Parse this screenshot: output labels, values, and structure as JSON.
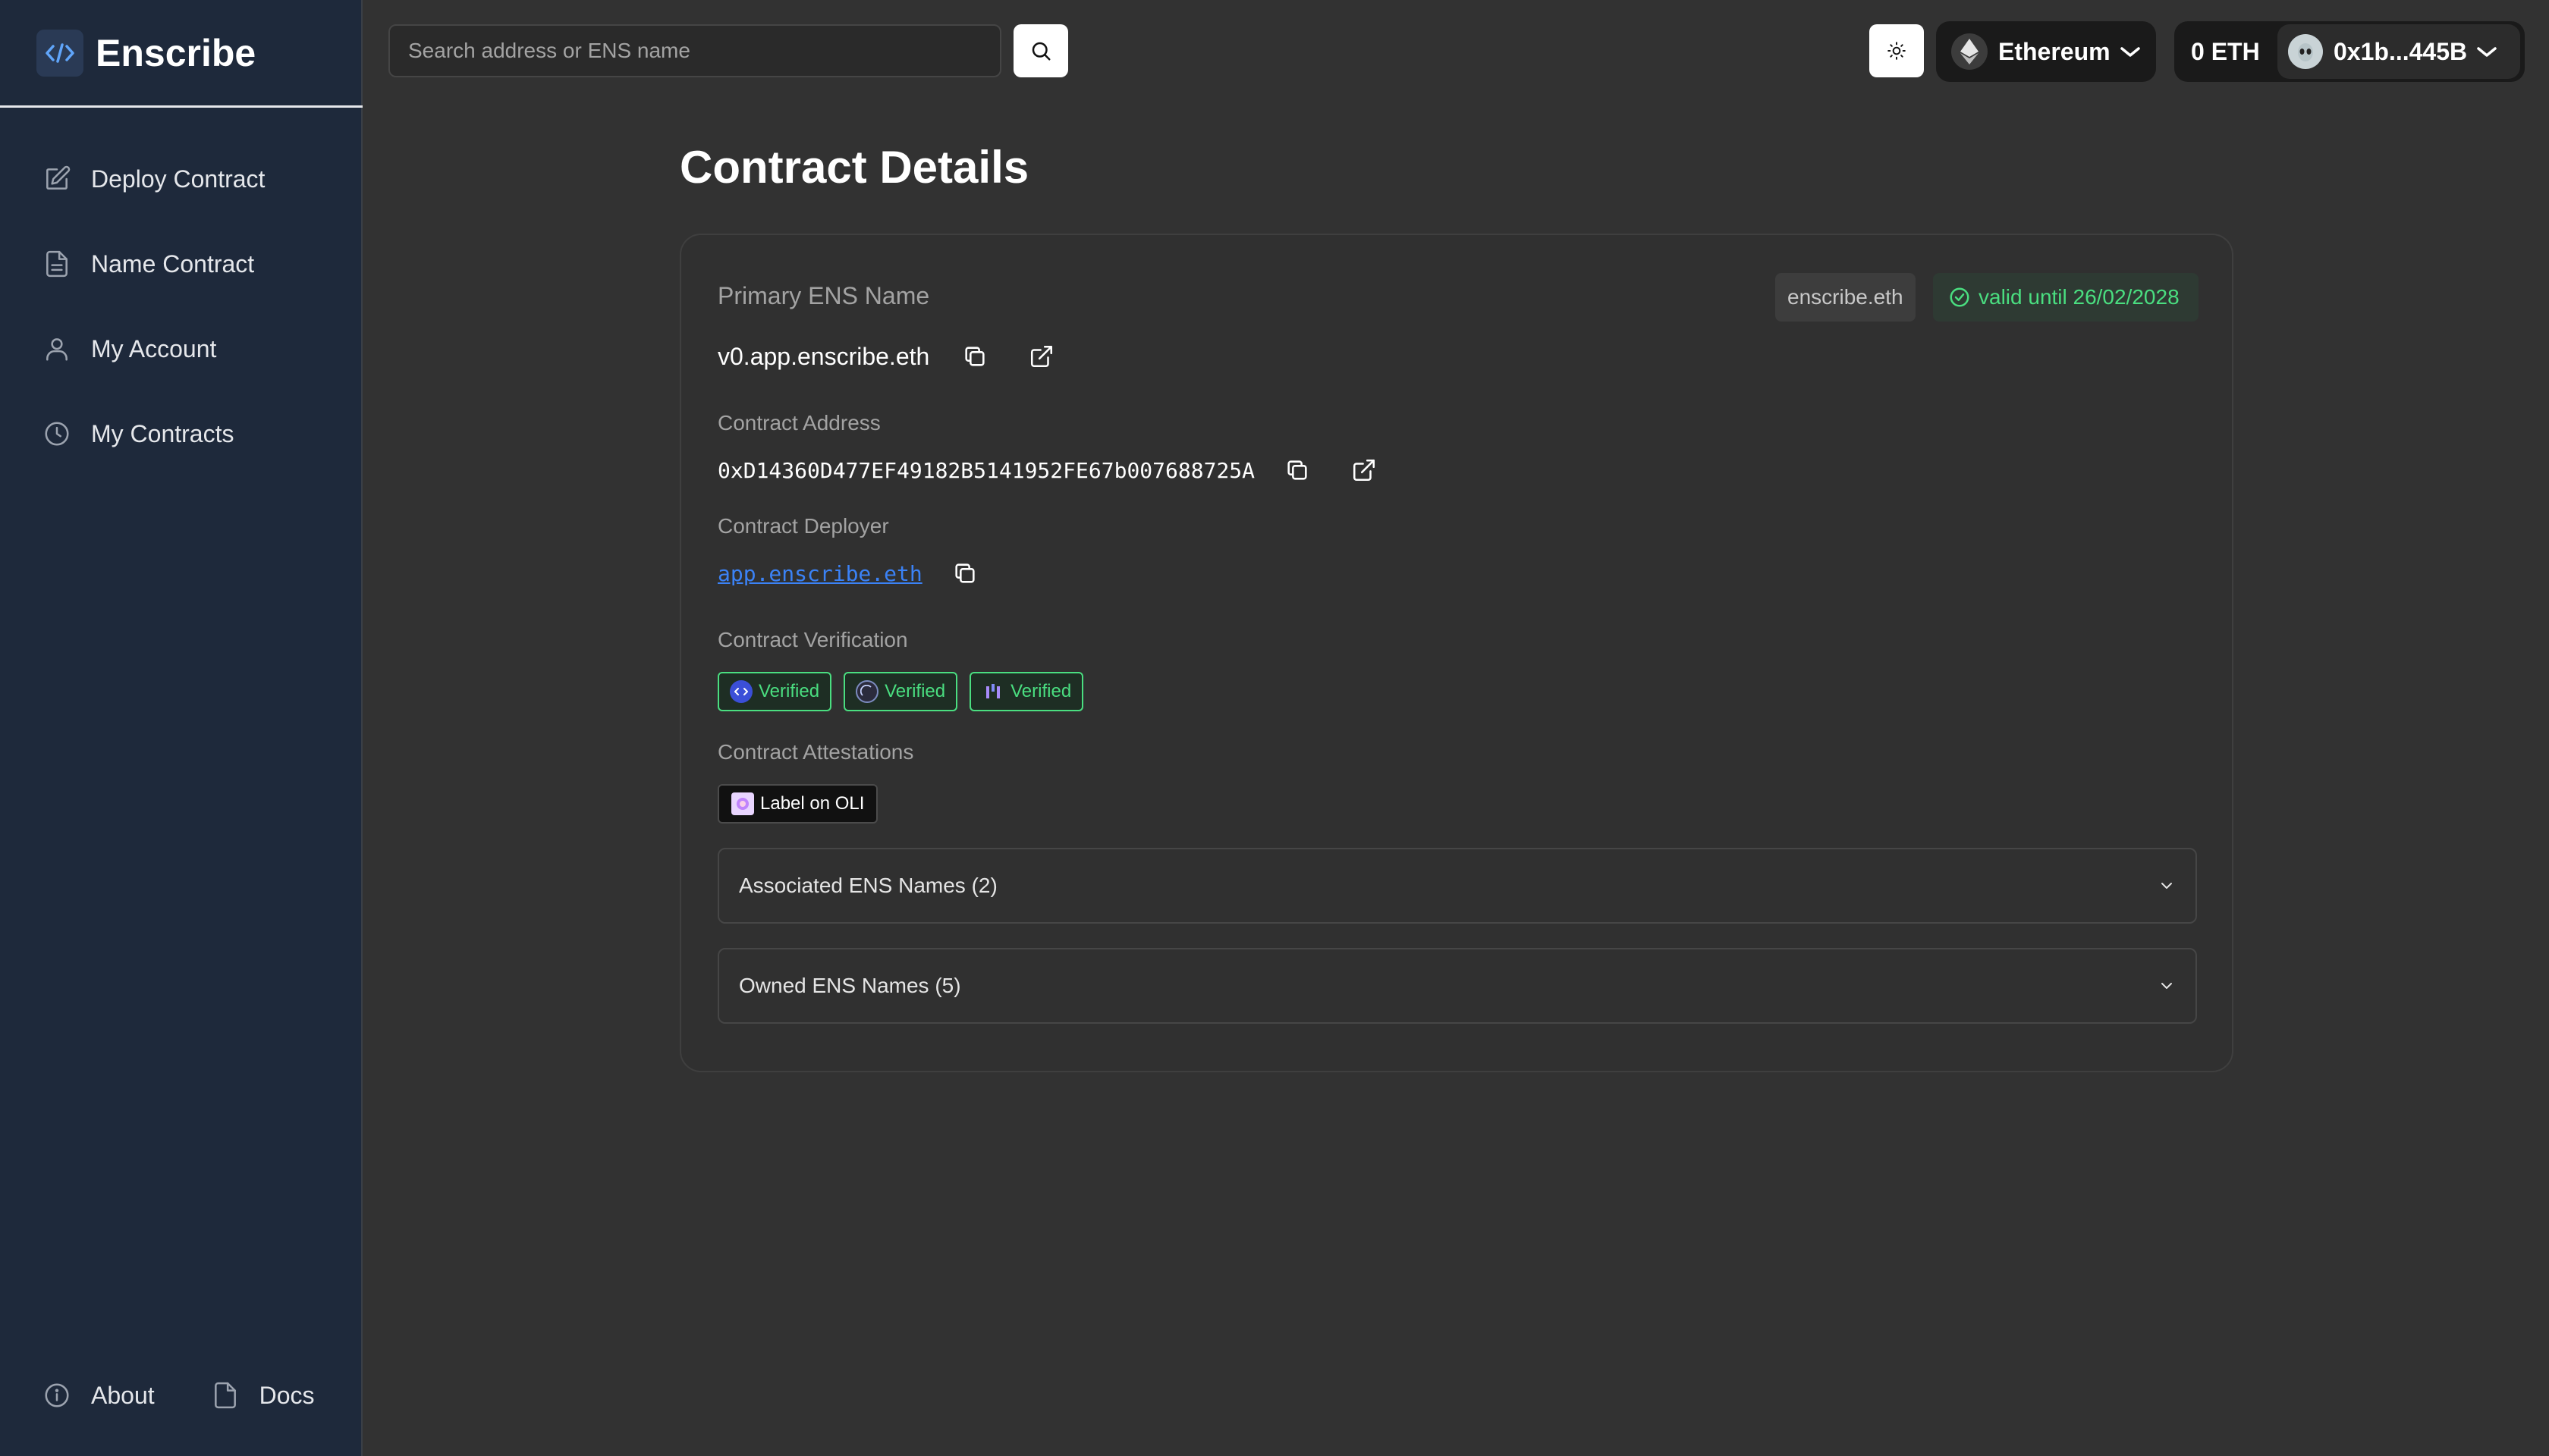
{
  "app": {
    "name": "Enscribe"
  },
  "sidebar": {
    "items": [
      {
        "label": "Deploy Contract",
        "icon": "pencil-square-icon"
      },
      {
        "label": "Name Contract",
        "icon": "document-icon"
      },
      {
        "label": "My Account",
        "icon": "user-icon"
      },
      {
        "label": "My Contracts",
        "icon": "clock-icon"
      }
    ],
    "footer": [
      {
        "label": "About",
        "icon": "info-icon"
      },
      {
        "label": "Docs",
        "icon": "file-icon"
      }
    ]
  },
  "header": {
    "search_placeholder": "Search address or ENS name",
    "network": "Ethereum",
    "balance": "0 ETH",
    "account": "0x1b...445B"
  },
  "main": {
    "title": "Contract Details",
    "primary_ens": {
      "label": "Primary ENS Name",
      "value": "v0.app.enscribe.eth",
      "tag": "enscribe.eth",
      "valid": "valid until 26/02/2028"
    },
    "contract_address": {
      "label": "Contract Address",
      "value": "0xD14360D477EF49182B5141952FE67b007688725A"
    },
    "deployer": {
      "label": "Contract Deployer",
      "value": "app.enscribe.eth"
    },
    "verification": {
      "label": "Contract Verification",
      "badges": [
        "Verified",
        "Verified",
        "Verified"
      ]
    },
    "attestations": {
      "label": "Contract Attestations",
      "badge": "Label on OLI"
    },
    "accordions": [
      {
        "label": "Associated ENS Names (2)"
      },
      {
        "label": "Owned ENS Names (5)"
      }
    ]
  },
  "colors": {
    "sidebar": "#1e293b",
    "background": "#323232",
    "accent_green": "#4ade80",
    "link": "#3b82f6"
  }
}
